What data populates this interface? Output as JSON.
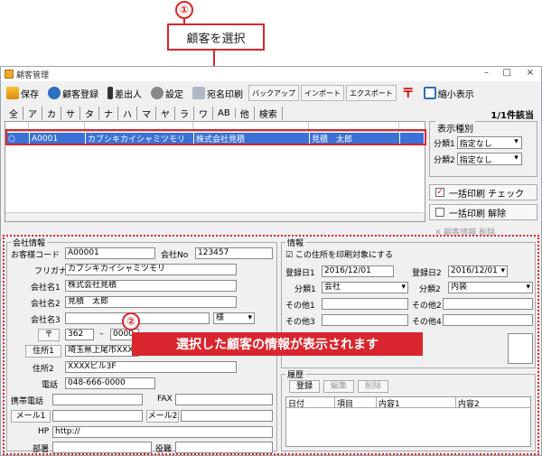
{
  "callouts": {
    "one_num": "①",
    "one_text": "顧客を選択",
    "two_num": "②",
    "two_text": "選択した顧客の情報が表示されます"
  },
  "window": {
    "title": "顧客管理",
    "min": "–",
    "max": "□",
    "close": "×"
  },
  "toolbar": {
    "save": "保存",
    "register": "顧客登録",
    "sender": "差出人",
    "settings": "設定",
    "address_print": "宛名印刷",
    "backup": "バックアップ",
    "import": "インポート",
    "export": "エクスポート",
    "shrink": "縮小表示"
  },
  "tabs": [
    "全",
    "ア",
    "カ",
    "サ",
    "タ",
    "ナ",
    "ハ",
    "マ",
    "ヤ",
    "ラ",
    "ワ",
    "AB",
    "他",
    "検索"
  ],
  "count": "1/1件該当",
  "row": {
    "code": "A0001",
    "kana": "カブシキカイシャミツモリ",
    "company": "株式会社見積",
    "person": "見積　太郎"
  },
  "right": {
    "legend": "表示種別",
    "cat1_label": "分類1",
    "cat1_value": "指定なし",
    "cat2_label": "分類2",
    "cat2_value": "指定なし",
    "bulk_check": "一括印刷 チェック",
    "bulk_clear": "一括印刷 解除",
    "delete": "顧客情報 削除"
  },
  "company": {
    "legend": "会社情報",
    "code_label": "お客様コード",
    "code": "A00001",
    "no_label": "会社No",
    "no": "123457",
    "kana_label": "フリガナ",
    "kana": "カブシキカイシャミツモリ",
    "name1_label": "会社名1",
    "name1": "株式会社見積",
    "name2_label": "会社名2",
    "name2": "見積　太郎",
    "name3_label": "会社名3",
    "honor": "様",
    "zip_btn": "〒",
    "zip1": "362",
    "zip_sep": "–",
    "zip2": "0000",
    "addr1_btn": "住所1",
    "addr1": "埼玉県上尾市XXX1-1",
    "addr2_label": "住所2",
    "addr2": "XXXXビル3F",
    "tel_label": "電話",
    "tel": "048-666-0000",
    "mobile_label": "携帯電話",
    "fax_label": "FAX",
    "mail1_btn": "メール1",
    "mail2_btn": "メール2",
    "hp_label": "HP",
    "hp": "http://",
    "dept_label": "部署",
    "title_label": "役職"
  },
  "info": {
    "legend": "情報",
    "print_target": "この住所を印刷対象にする",
    "reg1_label": "登録日1",
    "reg1": "2016/12/01",
    "reg2_label": "登録日2",
    "reg2": "2016/12/01",
    "cls1_label": "分類1",
    "cls1": "会社",
    "cls2_label": "分類2",
    "cls2": "内装",
    "o1": "その他1",
    "o2": "その他2",
    "o3": "その他3",
    "o4": "その他4"
  },
  "history": {
    "legend": "履歴",
    "add": "登録",
    "edit": "編集",
    "del": "削除",
    "cols": [
      "日付",
      "項目",
      "内容1",
      "内容2"
    ]
  }
}
